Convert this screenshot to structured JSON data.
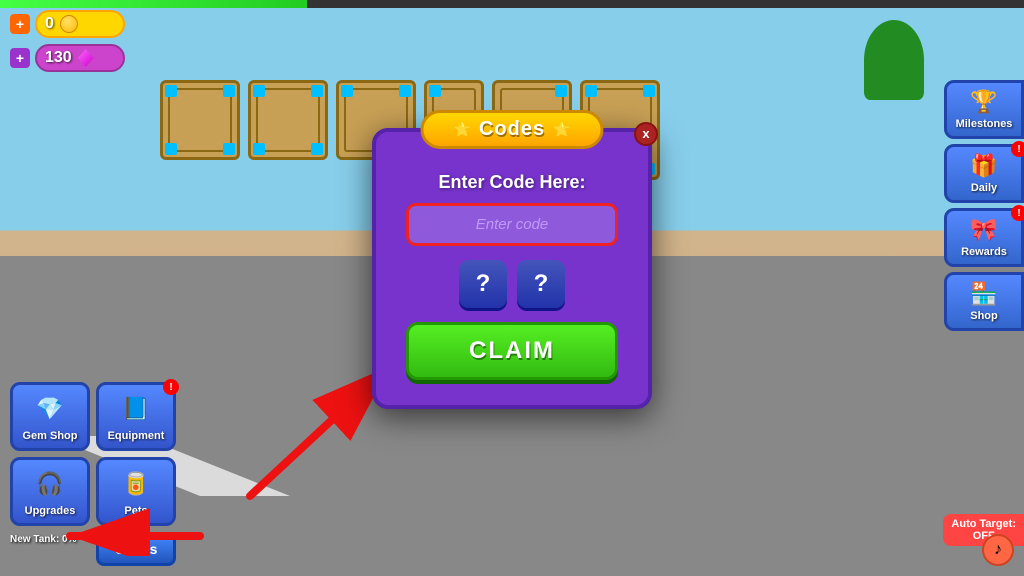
{
  "game": {
    "title": "Codes"
  },
  "hud": {
    "coins": "0",
    "gems": "130",
    "coin_label": "coins",
    "gem_label": "gems"
  },
  "progress_bar": {
    "fill_percent": 30
  },
  "modal": {
    "title": "Codes",
    "close_label": "x",
    "enter_code_label": "Enter Code Here:",
    "input_placeholder": "Enter code",
    "mystery_btn1": "?",
    "mystery_btn2": "?",
    "claim_label": "CLAIM"
  },
  "bottom_buttons": [
    {
      "id": "gem-shop",
      "label": "Gem Shop",
      "icon": "💎",
      "has_badge": false
    },
    {
      "id": "equipment",
      "label": "Equipment",
      "icon": "📘",
      "has_badge": true
    },
    {
      "id": "upgrades",
      "label": "Upgrades",
      "icon": "🎧",
      "has_badge": false
    },
    {
      "id": "pets",
      "label": "Pets",
      "icon": "🥫",
      "has_badge": false
    }
  ],
  "new_tank_text": "New Tank: 0%",
  "codes_button_label": "Codes",
  "right_buttons": [
    {
      "id": "milestones",
      "label": "Milestones",
      "icon": "🏆",
      "has_badge": false
    },
    {
      "id": "daily",
      "label": "Daily",
      "icon": "🎁",
      "has_badge": true
    },
    {
      "id": "rewards",
      "label": "Rewards",
      "icon": "🎀",
      "has_badge": true
    },
    {
      "id": "shop",
      "label": "Shop",
      "icon": "🏪",
      "has_badge": false
    }
  ],
  "auto_target": {
    "label": "Auto Target:\nOFF"
  },
  "music_icon": "♪",
  "colors": {
    "modal_bg": "#7733CC",
    "modal_border": "#5522AA",
    "title_bg": "#FFD700",
    "claim_bg": "#33BB11",
    "input_border": "#EE2222",
    "arrow_color": "#EE1111"
  }
}
